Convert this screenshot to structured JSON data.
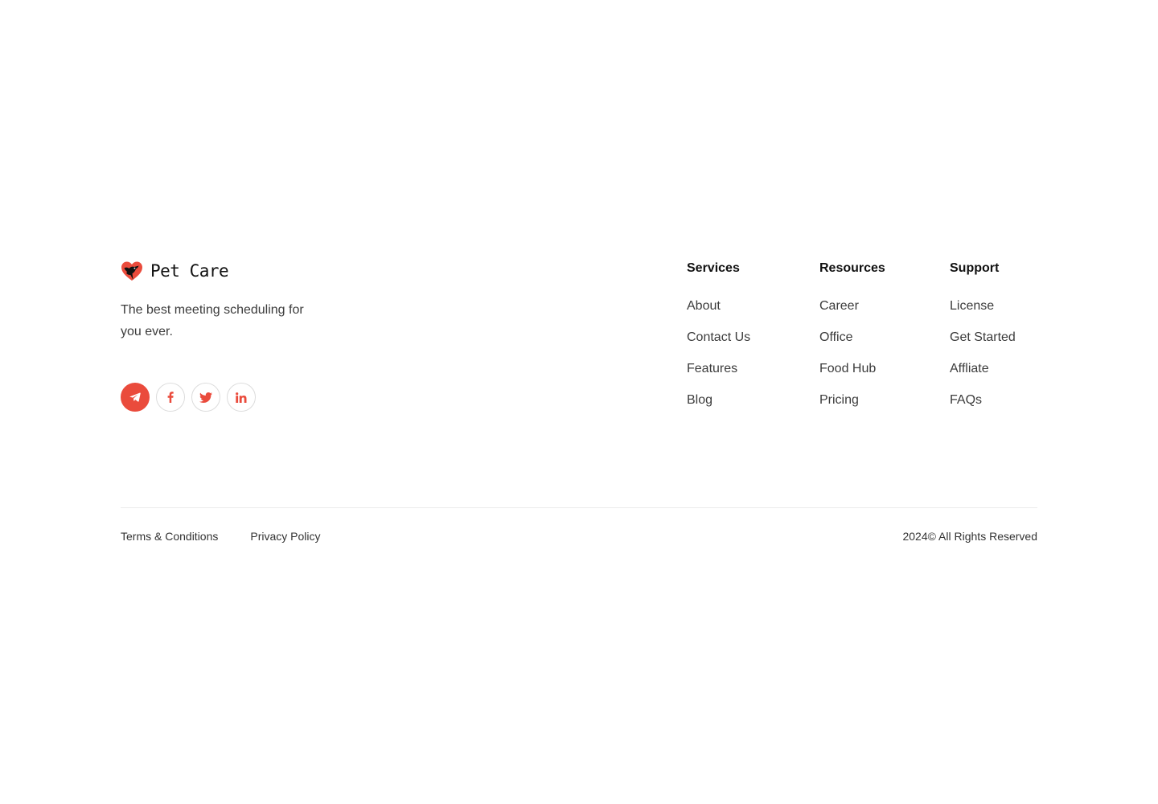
{
  "brand": {
    "name": "Pet Care",
    "tagline": "The best meeting scheduling for you ever.",
    "logo_icon": "heart-paw-logo-icon",
    "accent_color": "#ea4b3c"
  },
  "socials": [
    {
      "name": "telegram",
      "icon": "telegram-icon",
      "active": true
    },
    {
      "name": "facebook",
      "icon": "facebook-icon",
      "active": false
    },
    {
      "name": "twitter",
      "icon": "twitter-icon",
      "active": false
    },
    {
      "name": "linkedin",
      "icon": "linkedin-icon",
      "active": false
    }
  ],
  "columns": {
    "services": {
      "title": "Services",
      "links": [
        "About",
        "Contact Us",
        "Features",
        "Blog"
      ]
    },
    "resources": {
      "title": "Resources",
      "links": [
        "Career",
        "Office",
        "Food Hub",
        "Pricing"
      ]
    },
    "support": {
      "title": "Support",
      "links": [
        "License",
        "Get Started",
        "Affliate",
        "FAQs"
      ]
    }
  },
  "bottom": {
    "terms": "Terms & Conditions",
    "privacy": "Privacy Policy",
    "copyright": "2024© All Rights Reserved"
  }
}
